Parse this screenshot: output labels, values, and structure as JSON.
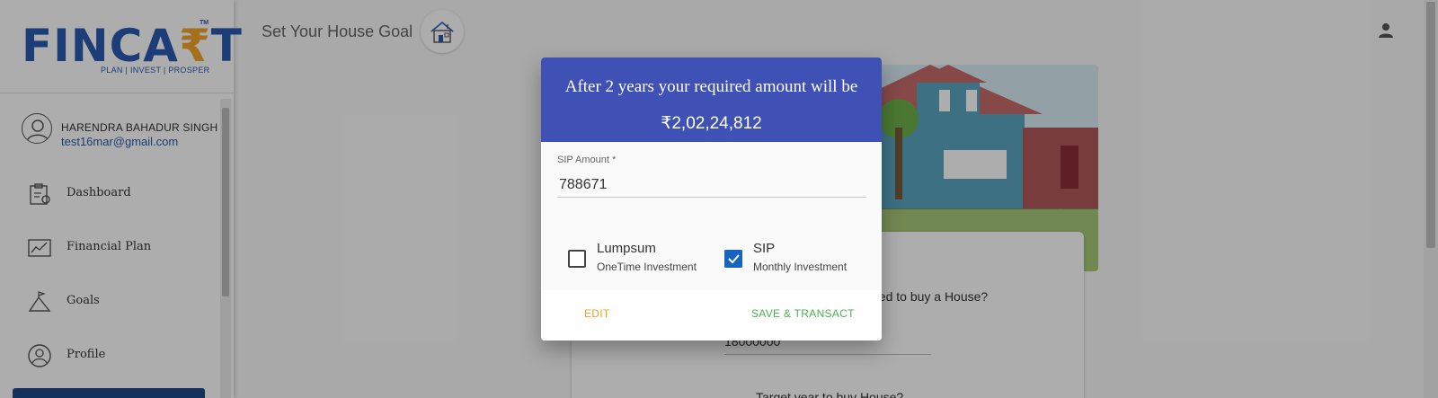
{
  "brand": {
    "logo_text_1": "FINCA",
    "logo_rupee": "₹",
    "logo_text_2": "T",
    "trademark": "TM",
    "tagline": "PLAN | INVEST | PROSPER",
    "primary_color": "#2a5bb0",
    "accent_color": "#f4a62a"
  },
  "user": {
    "name": "HARENDRA BAHADUR SINGH",
    "email": "test16mar@gmail.com"
  },
  "sidebar": {
    "items": [
      {
        "label": "Dashboard",
        "icon": "dashboard-icon"
      },
      {
        "label": "Financial Plan",
        "icon": "chart-icon"
      },
      {
        "label": "Goals",
        "icon": "mountain-flag-icon"
      },
      {
        "label": "Profile",
        "icon": "user-circle-icon"
      }
    ]
  },
  "header": {
    "title": "Set Your House Goal",
    "goal_icon": "house-icon",
    "account_icon": "person-icon"
  },
  "background_form": {
    "question_1": "eed to buy a House?",
    "value_1": "18000000",
    "question_2": "Target year to buy House?"
  },
  "dialog": {
    "title": "After 2 years your required amount will be",
    "amount": "₹2,02,24,812",
    "header_color": "#3f51b5",
    "sip_label": "SIP Amount *",
    "sip_value": "788671",
    "options": {
      "lumpsum": {
        "title": "Lumpsum",
        "subtitle": "OneTime Investment",
        "checked": false
      },
      "sip": {
        "title": "SIP",
        "subtitle": "Monthly Investment",
        "checked": true
      }
    },
    "edit_label": "EDIT",
    "save_label": "SAVE & TRANSACT"
  }
}
